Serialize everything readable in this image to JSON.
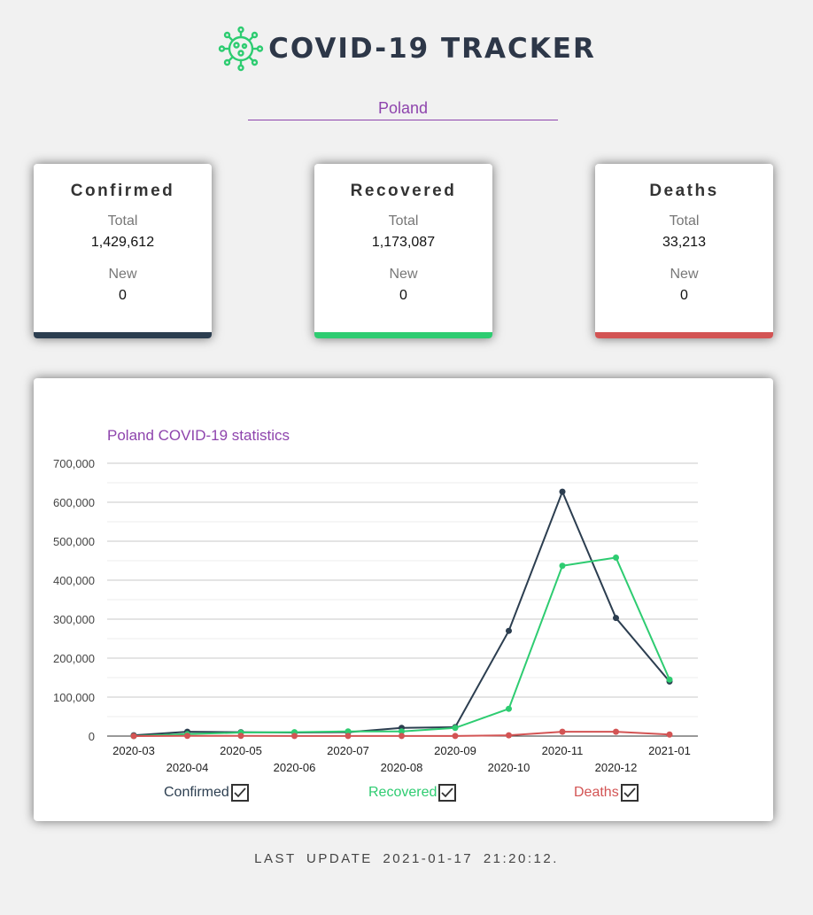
{
  "app": {
    "title": "COVID-19 TRACKER",
    "logo_icon": "virus-icon"
  },
  "country_select": {
    "selected": "Poland"
  },
  "cards": [
    {
      "title": "Confirmed",
      "total_label": "Total",
      "total": "1,429,612",
      "new_label": "New",
      "new": "0",
      "color": "#2c3e50"
    },
    {
      "title": "Recovered",
      "total_label": "Total",
      "total": "1,173,087",
      "new_label": "New",
      "new": "0",
      "color": "#2ecc71"
    },
    {
      "title": "Deaths",
      "total_label": "Total",
      "total": "33,213",
      "new_label": "New",
      "new": "0",
      "color": "#d35454"
    }
  ],
  "chart_data": {
    "type": "line",
    "title": "Poland COVID-19 statistics",
    "title_color": "#8e44ad",
    "categories": [
      "2020-03",
      "2020-04",
      "2020-05",
      "2020-06",
      "2020-07",
      "2020-08",
      "2020-09",
      "2020-10",
      "2020-11",
      "2020-12",
      "2021-01"
    ],
    "ylim": [
      0,
      700000
    ],
    "yticks": [
      "0",
      "100,000",
      "200,000",
      "300,000",
      "400,000",
      "500,000",
      "600,000",
      "700,000"
    ],
    "grid": true,
    "legend_position": "bottom",
    "series": [
      {
        "name": "Confirmed",
        "color": "#2c3e50",
        "values": [
          2000,
          11000,
          10000,
          9000,
          10000,
          21000,
          23000,
          270000,
          627000,
          303000,
          140000
        ]
      },
      {
        "name": "Recovered",
        "color": "#2ecc71",
        "values": [
          0,
          5000,
          9000,
          10000,
          12000,
          12000,
          21000,
          70000,
          437000,
          458000,
          145000
        ]
      },
      {
        "name": "Deaths",
        "color": "#d35454",
        "values": [
          0,
          500,
          500,
          200,
          200,
          200,
          200,
          2000,
          11000,
          11000,
          4000
        ]
      }
    ]
  },
  "legend": [
    {
      "label": "Confirmed",
      "checked": true
    },
    {
      "label": "Recovered",
      "checked": true
    },
    {
      "label": "Deaths",
      "checked": true
    }
  ],
  "footer": {
    "last_update": "LAST UPDATE 2021-01-17 21:20:12."
  }
}
